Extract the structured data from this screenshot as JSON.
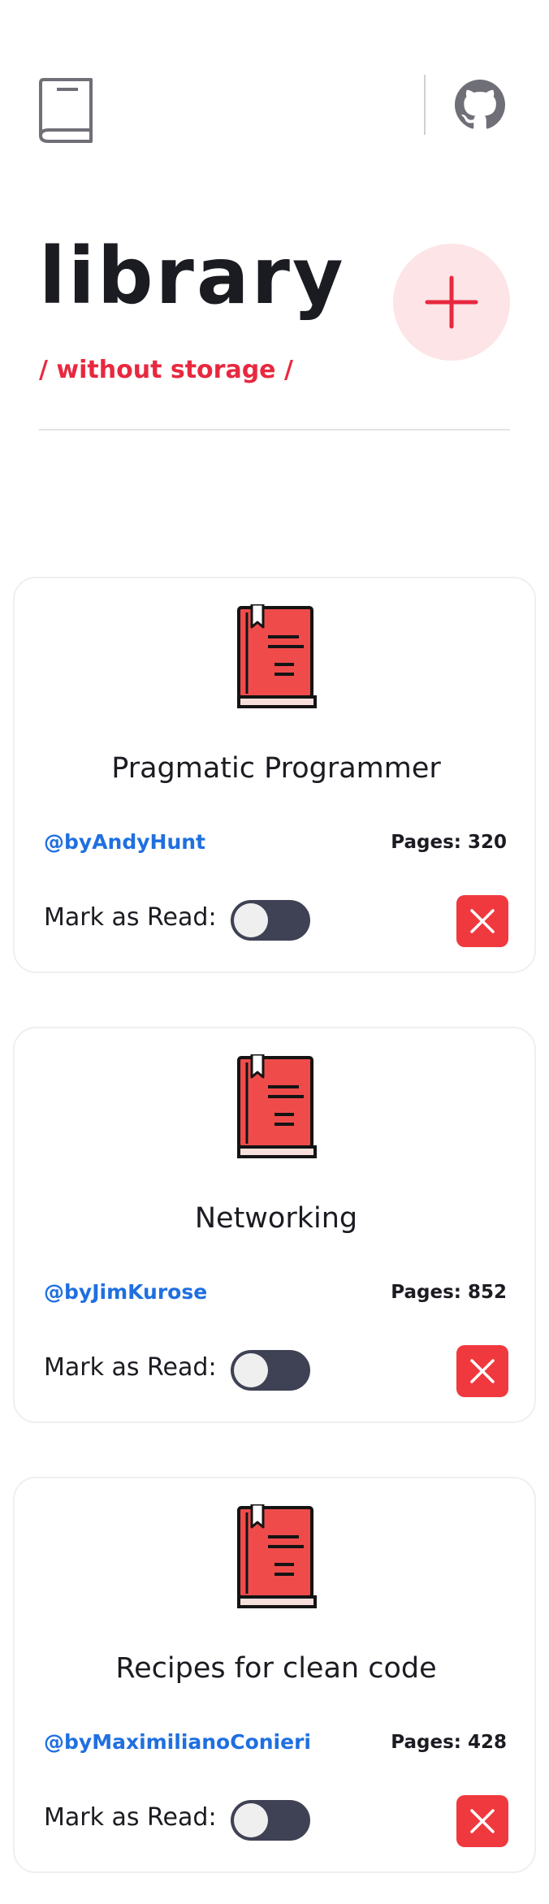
{
  "header": {
    "title": "library",
    "subtitle": "/ without storage /",
    "logo_icon": "book-outline-icon",
    "github_icon": "github-icon",
    "add_icon": "plus-icon"
  },
  "colors": {
    "accent": "#e8283f",
    "author_link": "#1f6fe0",
    "toggle_track": "#3f4154",
    "delete": "#f0393e",
    "add_button_bg": "#fde4e6"
  },
  "cards": [
    {
      "title": "Pragmatic Programmer",
      "author": "@byAndyHunt",
      "pages": "Pages: 320",
      "mark_label": "Mark as Read:",
      "read": false
    },
    {
      "title": "Networking",
      "author": "@byJimKurose",
      "pages": "Pages: 852",
      "mark_label": "Mark as Read:",
      "read": false
    },
    {
      "title": "Recipes for clean code",
      "author": "@byMaximilianoConieri",
      "pages": "Pages: 428",
      "mark_label": "Mark as Read:",
      "read": false
    }
  ]
}
